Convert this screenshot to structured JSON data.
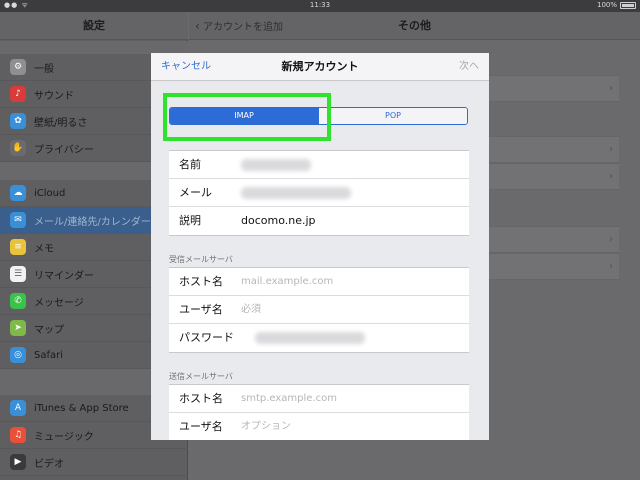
{
  "status": {
    "signal": "●● ᯤ",
    "time": "11:33",
    "battery": "100%"
  },
  "sidebar": {
    "title": "設定",
    "items": [
      {
        "label": "一般",
        "icon": "gear-icon",
        "color": "#8e8e93",
        "glyph": "⚙"
      },
      {
        "label": "サウンド",
        "icon": "speaker-icon",
        "color": "#d93a3a",
        "glyph": "♪"
      },
      {
        "label": "壁紙/明るさ",
        "icon": "flower-icon",
        "color": "#3a8fd9",
        "glyph": "✿"
      },
      {
        "label": "プライバシー",
        "icon": "hand-icon",
        "color": "#6b6b6e",
        "glyph": "✋"
      },
      {
        "label": "iCloud",
        "icon": "cloud-icon",
        "color": "#3a8fd9",
        "glyph": "☁"
      },
      {
        "label": "メール/連絡先/カレンダー",
        "icon": "mail-icon",
        "color": "#3a8fd9",
        "glyph": "✉"
      },
      {
        "label": "メモ",
        "icon": "notes-icon",
        "color": "#e8c43a",
        "glyph": "≡"
      },
      {
        "label": "リマインダー",
        "icon": "list-icon",
        "color": "#f2f2f2",
        "glyph": "☰"
      },
      {
        "label": "メッセージ",
        "icon": "message-icon",
        "color": "#3ac24a",
        "glyph": "✆"
      },
      {
        "label": "マップ",
        "icon": "map-icon",
        "color": "#7fb94a",
        "glyph": "➤"
      },
      {
        "label": "Safari",
        "icon": "compass-icon",
        "color": "#3a8fd9",
        "glyph": "◎"
      },
      {
        "label": "iTunes & App Store",
        "icon": "app-store-icon",
        "color": "#3a8fd9",
        "glyph": "A"
      },
      {
        "label": "ミュージック",
        "icon": "music-icon",
        "color": "#e8503a",
        "glyph": "♫"
      },
      {
        "label": "ビデオ",
        "icon": "video-icon",
        "color": "#3a3a3e",
        "glyph": "▶"
      }
    ]
  },
  "detail": {
    "back_label": "アカウントを追加",
    "title": "その他"
  },
  "modal": {
    "cancel_label": "キャンセル",
    "title": "新規アカウント",
    "next_label": "次へ",
    "segments": [
      "IMAP",
      "POP"
    ],
    "account": {
      "name_label": "名前",
      "email_label": "メール",
      "description_label": "説明",
      "description_value": "docomo.ne.jp"
    },
    "incoming": {
      "header": "受信メールサーバ",
      "host_label": "ホスト名",
      "host_placeholder": "mail.example.com",
      "user_label": "ユーザ名",
      "user_placeholder": "必須",
      "password_label": "パスワード"
    },
    "outgoing": {
      "header": "送信メールサーバ",
      "host_label": "ホスト名",
      "host_placeholder": "smtp.example.com",
      "user_label": "ユーザ名",
      "user_placeholder": "オプション"
    }
  }
}
